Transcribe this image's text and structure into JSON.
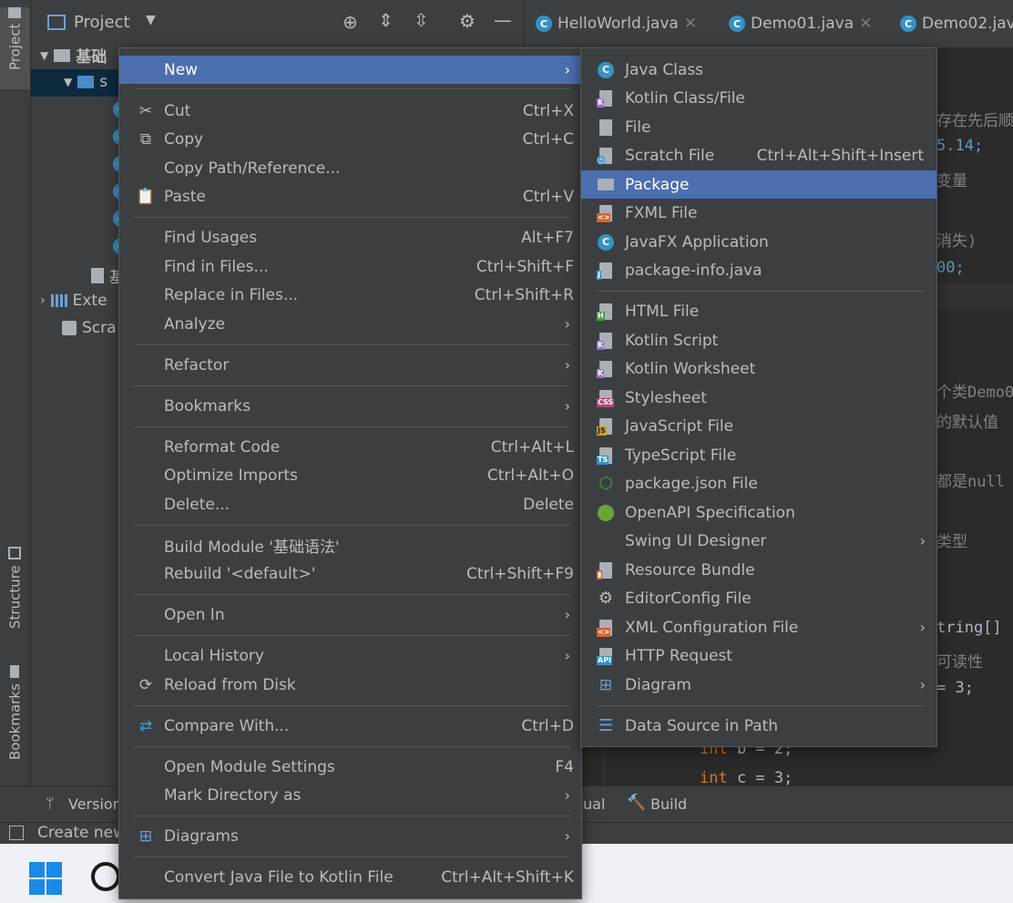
{
  "sidebar": {
    "project_tab": "Project",
    "structure_tab": "Structure",
    "bookmarks_tab": "Bookmarks"
  },
  "project_panel": {
    "title": "Project",
    "tree": [
      "基础",
      "s",
      "基",
      "Exte",
      "Scra"
    ]
  },
  "editor_tabs": [
    "HelloWorld.java",
    "Demo01.java",
    "Demo02.java"
  ],
  "code_lines": [
    {
      "text": "存在先后顺",
      "color": "#808080"
    },
    {
      "text": "5.14;",
      "color": "#6897bb"
    },
    {
      "text": "变量",
      "color": "#808080"
    },
    {
      "text": "消失)",
      "color": "#808080"
    },
    {
      "text": "00;",
      "color": "#6897bb"
    },
    {
      "text": "个类Demo0",
      "color": "#808080"
    },
    {
      "text": "的默认值",
      "color": "#808080"
    },
    {
      "text": "都是null",
      "color": "#808080"
    },
    {
      "text": "类型",
      "color": "#808080"
    },
    {
      "text": "tring[]",
      "color": "#a9b7c6"
    },
    {
      "text": "可读性",
      "color": "#808080"
    },
    {
      "text": "= 3;",
      "color": "#a9b7c6"
    },
    {
      "text": "int b = 2;",
      "color": "#a9b7c6"
    },
    {
      "text": "int c = 3;",
      "color": "#a9b7c6"
    }
  ],
  "bottom_bar": {
    "version": "Version",
    "ual": "ual",
    "build": "Build",
    "create": "Create new"
  },
  "context_menu": {
    "items": [
      {
        "label": "New",
        "shortcut": "",
        "submenu": true,
        "icon": "none"
      },
      {
        "label": "Cut",
        "shortcut": "Ctrl+X",
        "submenu": false,
        "icon": "scissors-icon"
      },
      {
        "label": "Copy",
        "shortcut": "Ctrl+C",
        "submenu": false,
        "icon": "copy-icon"
      },
      {
        "label": "Copy Path/Reference...",
        "shortcut": "",
        "submenu": false,
        "icon": "none"
      },
      {
        "label": "Paste",
        "shortcut": "Ctrl+V",
        "submenu": false,
        "icon": "paste-icon"
      },
      {
        "label": "Find Usages",
        "shortcut": "Alt+F7",
        "submenu": false,
        "icon": "none"
      },
      {
        "label": "Find in Files...",
        "shortcut": "Ctrl+Shift+F",
        "submenu": false,
        "icon": "none"
      },
      {
        "label": "Replace in Files...",
        "shortcut": "Ctrl+Shift+R",
        "submenu": false,
        "icon": "none"
      },
      {
        "label": "Analyze",
        "shortcut": "",
        "submenu": true,
        "icon": "none"
      },
      {
        "label": "Refactor",
        "shortcut": "",
        "submenu": true,
        "icon": "none"
      },
      {
        "label": "Bookmarks",
        "shortcut": "",
        "submenu": true,
        "icon": "none"
      },
      {
        "label": "Reformat Code",
        "shortcut": "Ctrl+Alt+L",
        "submenu": false,
        "icon": "none"
      },
      {
        "label": "Optimize Imports",
        "shortcut": "Ctrl+Alt+O",
        "submenu": false,
        "icon": "none"
      },
      {
        "label": "Delete...",
        "shortcut": "Delete",
        "submenu": false,
        "icon": "none"
      },
      {
        "label": "Build Module '基础语法'",
        "shortcut": "",
        "submenu": false,
        "icon": "none"
      },
      {
        "label": "Rebuild '<default>'",
        "shortcut": "Ctrl+Shift+F9",
        "submenu": false,
        "icon": "none"
      },
      {
        "label": "Open In",
        "shortcut": "",
        "submenu": true,
        "icon": "none"
      },
      {
        "label": "Local History",
        "shortcut": "",
        "submenu": true,
        "icon": "none"
      },
      {
        "label": "Reload from Disk",
        "shortcut": "",
        "submenu": false,
        "icon": "reload-icon"
      },
      {
        "label": "Compare With...",
        "shortcut": "Ctrl+D",
        "submenu": false,
        "icon": "compare-icon"
      },
      {
        "label": "Open Module Settings",
        "shortcut": "F4",
        "submenu": false,
        "icon": "none"
      },
      {
        "label": "Mark Directory as",
        "shortcut": "",
        "submenu": true,
        "icon": "none"
      },
      {
        "label": "Diagrams",
        "shortcut": "",
        "submenu": true,
        "icon": "diagram-icon"
      },
      {
        "label": "Convert Java File to Kotlin File",
        "shortcut": "Ctrl+Alt+Shift+K",
        "submenu": false,
        "icon": "none"
      }
    ]
  },
  "new_submenu": {
    "items": [
      {
        "label": "Java Class",
        "shortcut": "",
        "submenu": false,
        "icon": "java-class-icon"
      },
      {
        "label": "Kotlin Class/File",
        "shortcut": "",
        "submenu": false,
        "icon": "kotlin-file-icon"
      },
      {
        "label": "File",
        "shortcut": "",
        "submenu": false,
        "icon": "file-icon"
      },
      {
        "label": "Scratch File",
        "shortcut": "Ctrl+Alt+Shift+Insert",
        "submenu": false,
        "icon": "scratch-file-icon"
      },
      {
        "label": "Package",
        "shortcut": "",
        "submenu": false,
        "icon": "package-icon"
      },
      {
        "label": "FXML File",
        "shortcut": "",
        "submenu": false,
        "icon": "fxml-file-icon"
      },
      {
        "label": "JavaFX Application",
        "shortcut": "",
        "submenu": false,
        "icon": "javafx-icon"
      },
      {
        "label": "package-info.java",
        "shortcut": "",
        "submenu": false,
        "icon": "package-info-icon"
      },
      {
        "label": "HTML File",
        "shortcut": "",
        "submenu": false,
        "icon": "html-file-icon"
      },
      {
        "label": "Kotlin Script",
        "shortcut": "",
        "submenu": false,
        "icon": "kotlin-script-icon"
      },
      {
        "label": "Kotlin Worksheet",
        "shortcut": "",
        "submenu": false,
        "icon": "kotlin-worksheet-icon"
      },
      {
        "label": "Stylesheet",
        "shortcut": "",
        "submenu": false,
        "icon": "css-file-icon"
      },
      {
        "label": "JavaScript File",
        "shortcut": "",
        "submenu": false,
        "icon": "js-file-icon"
      },
      {
        "label": "TypeScript File",
        "shortcut": "",
        "submenu": false,
        "icon": "ts-file-icon"
      },
      {
        "label": "package.json File",
        "shortcut": "",
        "submenu": false,
        "icon": "nodejs-icon"
      },
      {
        "label": "OpenAPI Specification",
        "shortcut": "",
        "submenu": false,
        "icon": "openapi-icon"
      },
      {
        "label": "Swing UI Designer",
        "shortcut": "",
        "submenu": true,
        "icon": "none"
      },
      {
        "label": "Resource Bundle",
        "shortcut": "",
        "submenu": false,
        "icon": "resource-bundle-icon"
      },
      {
        "label": "EditorConfig File",
        "shortcut": "",
        "submenu": false,
        "icon": "gear-icon"
      },
      {
        "label": "XML Configuration File",
        "shortcut": "",
        "submenu": true,
        "icon": "xml-file-icon"
      },
      {
        "label": "HTTP Request",
        "shortcut": "",
        "submenu": false,
        "icon": "api-icon"
      },
      {
        "label": "Diagram",
        "shortcut": "",
        "submenu": true,
        "icon": "diagram-icon"
      },
      {
        "label": "Data Source in Path",
        "shortcut": "",
        "submenu": false,
        "icon": "database-icon"
      }
    ]
  },
  "colors": {
    "selection": "#4b6eaf",
    "menu_bg": "#3c3f41",
    "editor_bg": "#2b2b2b",
    "keyword": "#cc7832"
  }
}
